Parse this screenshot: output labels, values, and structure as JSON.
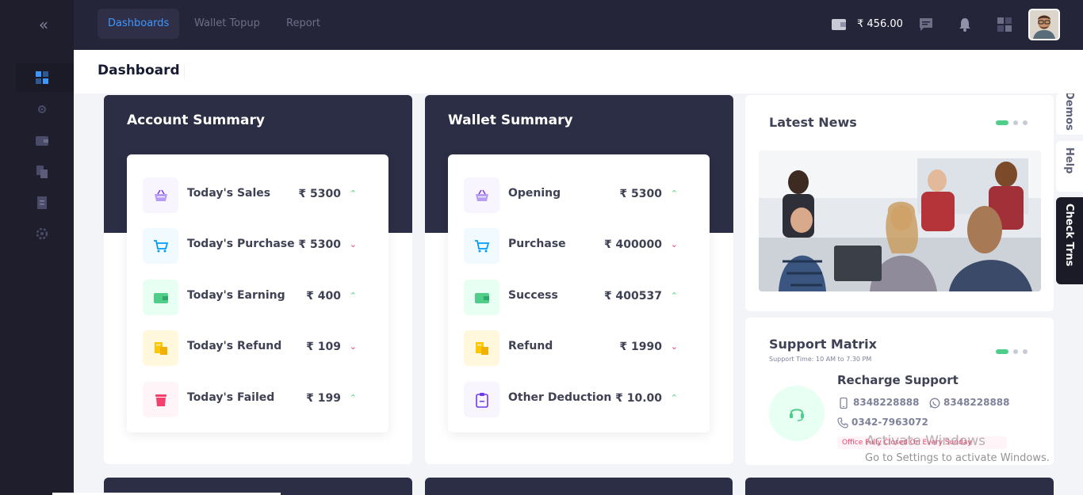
{
  "sidebar": {
    "collapse_icon": "double-chevron-left-icon",
    "items": [
      {
        "icon": "dashboard-grid-icon",
        "active": true
      },
      {
        "icon": "gear-sprocket-icon",
        "active": false
      },
      {
        "icon": "wallet-icon",
        "active": false
      },
      {
        "icon": "documents-icon",
        "active": false
      },
      {
        "icon": "report-file-icon",
        "active": false
      },
      {
        "icon": "settings-icon",
        "active": false
      }
    ]
  },
  "header": {
    "nav": [
      {
        "label": "Dashboards",
        "active": true
      },
      {
        "label": "Wallet Topup",
        "active": false
      },
      {
        "label": "Report",
        "active": false
      }
    ],
    "balance": "₹ 456.00",
    "icons": [
      "wallet-icon",
      "chat-icon",
      "bell-icon",
      "apps-grid-icon"
    ]
  },
  "page": {
    "title": "Dashboard"
  },
  "account_summary": {
    "title": "Account Summary",
    "rows": [
      {
        "label": "Today's Sales",
        "value": "₹ 5300",
        "trend": "up",
        "icon": "basket-icon"
      },
      {
        "label": "Today's Purchase",
        "value": "₹ 5300",
        "trend": "down",
        "icon": "cart-icon"
      },
      {
        "label": "Today's Earning",
        "value": "₹ 400",
        "trend": "up",
        "icon": "wallet-icon"
      },
      {
        "label": "Today's Refund",
        "value": "₹ 109",
        "trend": "down",
        "icon": "coins-icon"
      },
      {
        "label": "Today's Failed",
        "value": "₹ 199",
        "trend": "up",
        "icon": "trash-icon"
      }
    ]
  },
  "wallet_summary": {
    "title": "Wallet Summary",
    "rows": [
      {
        "label": "Opening",
        "value": "₹ 5300",
        "trend": "up",
        "icon": "basket-icon"
      },
      {
        "label": "Purchase",
        "value": "₹ 400000",
        "trend": "down",
        "icon": "cart-icon"
      },
      {
        "label": "Success",
        "value": "₹ 400537",
        "trend": "up",
        "icon": "wallet-icon"
      },
      {
        "label": "Refund",
        "value": "₹ 1990",
        "trend": "down",
        "icon": "coins-icon"
      },
      {
        "label": "Other Deduction",
        "value": "₹ 10.00",
        "trend": "up",
        "icon": "clipboard-icon"
      }
    ]
  },
  "news": {
    "title": "Latest News"
  },
  "support": {
    "title": "Support Matrix",
    "time": "Support Time: 10 AM to 7.30 PM",
    "recharge_title": "Recharge Support",
    "phone": "8348228888",
    "whatsapp": "8348228888",
    "landline": "0342-7963072",
    "office_note": "Office Fully Closed On Every Sunday"
  },
  "side_tabs": {
    "demos": "Demos",
    "help": "Help",
    "check": "Check Trns"
  },
  "watermark": {
    "line1": "Activate Windows",
    "line2": "Go to Settings to activate Windows."
  },
  "colors": {
    "accent": "#3e97ff",
    "up": "#50cd89",
    "down": "#f1416c",
    "card_header": "#2c2e45"
  }
}
